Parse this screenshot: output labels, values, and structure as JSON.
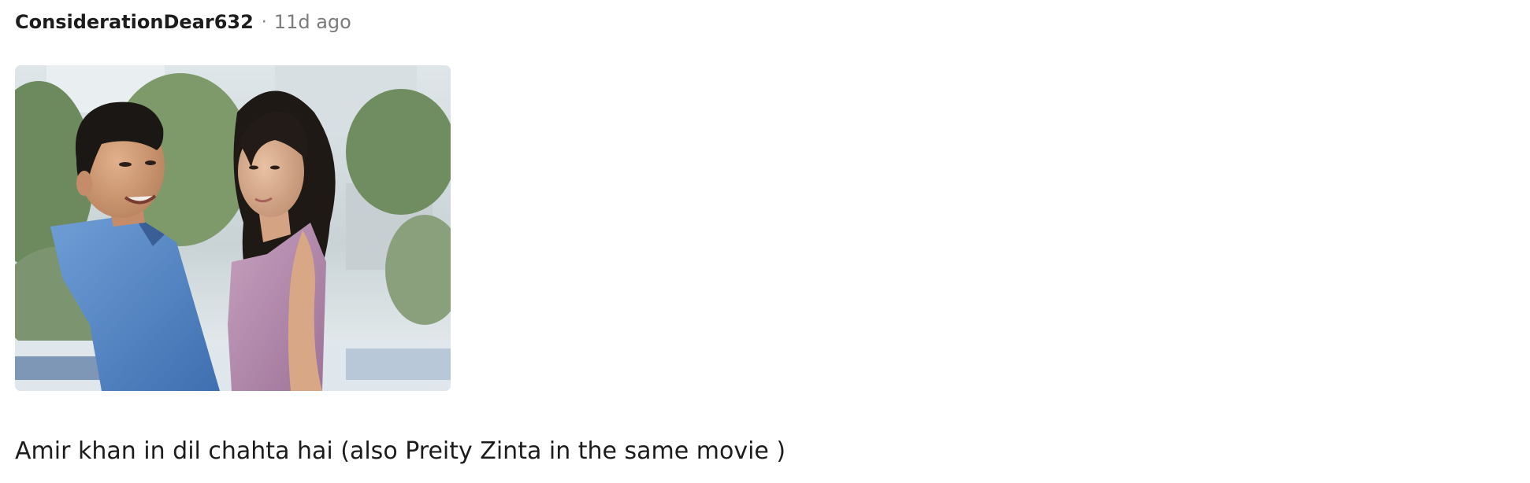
{
  "comment": {
    "author": "ConsiderationDear632",
    "separator": "·",
    "timestamp": "11d ago",
    "text": "Amir khan in dil chahta hai (also Preity Zinta in the same movie )"
  }
}
